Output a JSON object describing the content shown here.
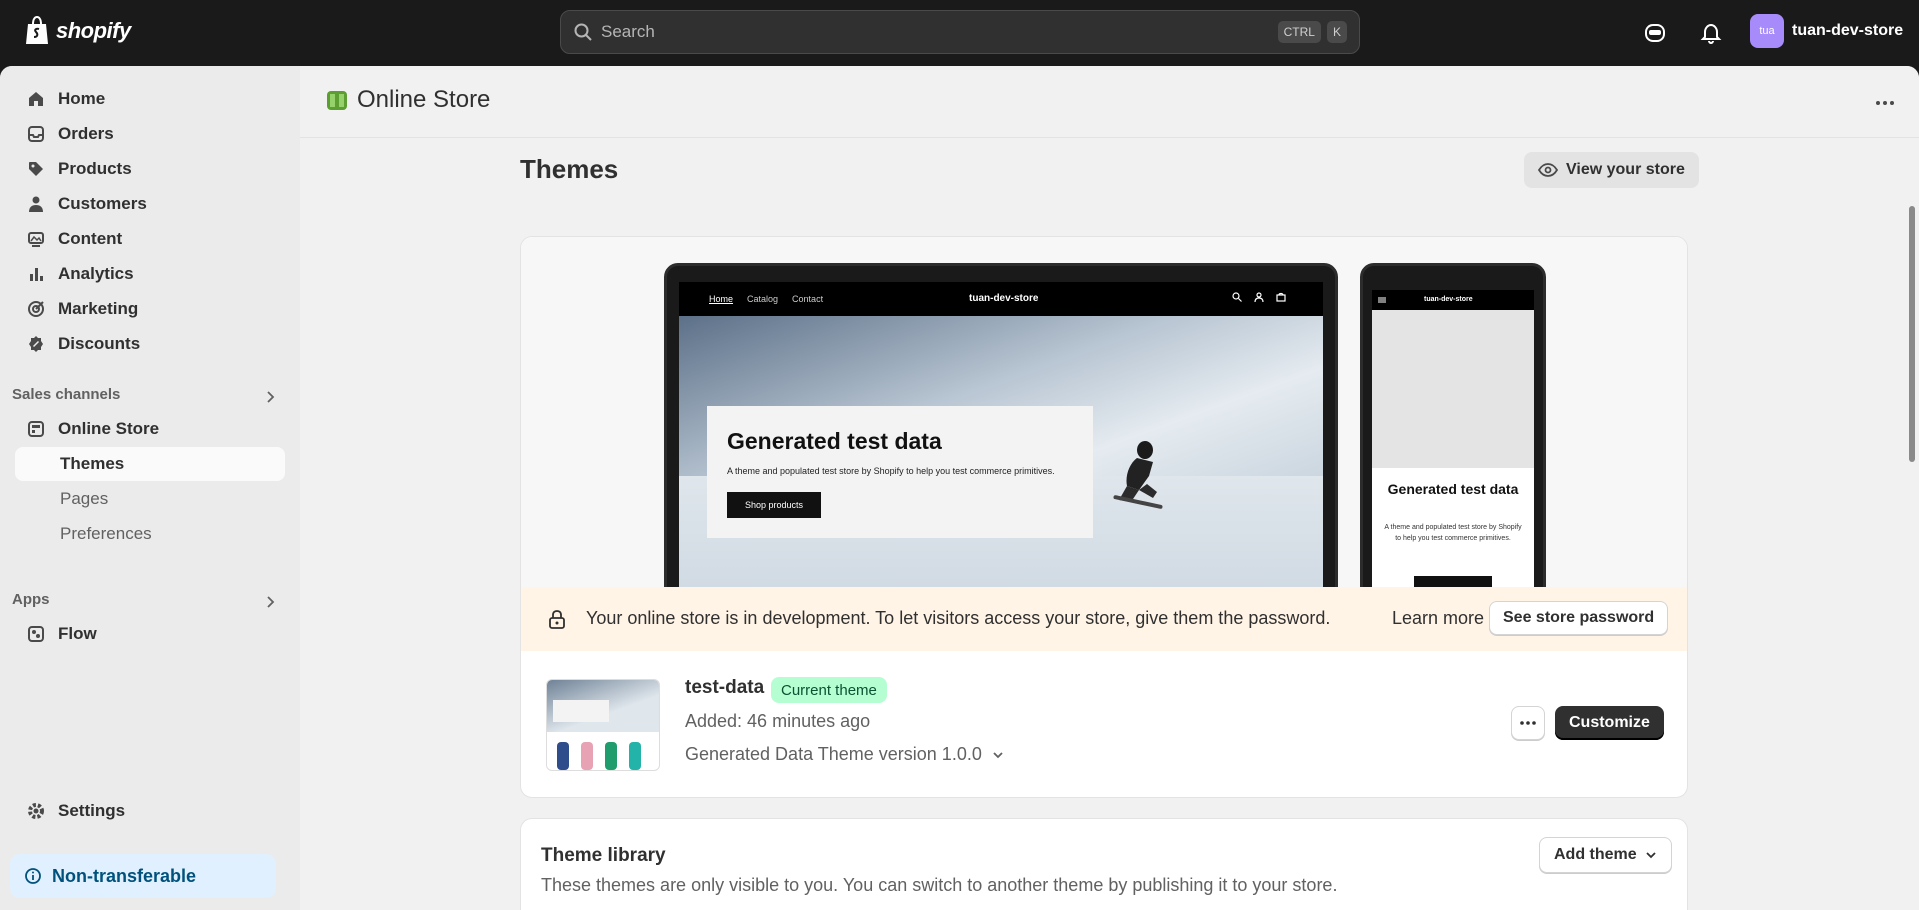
{
  "topbar": {
    "logo_text": "shopify",
    "search_placeholder": "Search",
    "shortcut_key1": "CTRL",
    "shortcut_key2": "K",
    "avatar_initials": "tua",
    "store_name": "tuan-dev-store"
  },
  "sidebar": {
    "items": [
      {
        "label": "Home",
        "icon": "home-icon"
      },
      {
        "label": "Orders",
        "icon": "inbox-icon"
      },
      {
        "label": "Products",
        "icon": "tag-icon"
      },
      {
        "label": "Customers",
        "icon": "person-icon"
      },
      {
        "label": "Content",
        "icon": "image-icon"
      },
      {
        "label": "Analytics",
        "icon": "bar-chart-icon"
      },
      {
        "label": "Marketing",
        "icon": "target-icon"
      },
      {
        "label": "Discounts",
        "icon": "discount-icon"
      }
    ],
    "sales_channels_label": "Sales channels",
    "online_store_label": "Online Store",
    "sub_items": [
      "Themes",
      "Pages",
      "Preferences"
    ],
    "apps_label": "Apps",
    "flow_label": "Flow",
    "settings_label": "Settings",
    "nontransferable_label": "Non-transferable"
  },
  "header": {
    "title": "Online Store"
  },
  "themes": {
    "title": "Themes",
    "view_store_label": "View your store"
  },
  "preview": {
    "nav_links": [
      "Home",
      "Catalog",
      "Contact"
    ],
    "brand": "tuan-dev-store",
    "hero_title": "Generated test data",
    "hero_desc": "A theme and populated test store by Shopify to help you test commerce primitives.",
    "hero_button": "Shop products",
    "phone_title": "Generated test data",
    "phone_desc": "A theme and populated test store by Shopify to help you test commerce primitives."
  },
  "banner": {
    "text": "Your online store is in development. To let visitors access your store, give them the password.",
    "learn_more": "Learn more",
    "password_button": "See store password"
  },
  "current_theme": {
    "name": "test-data",
    "badge": "Current theme",
    "added": "Added: 46 minutes ago",
    "version": "Generated Data Theme version 1.0.0",
    "customize_label": "Customize"
  },
  "library": {
    "title": "Theme library",
    "description": "These themes are only visible to you. You can switch to another theme by publishing it to your store.",
    "add_theme_label": "Add theme"
  },
  "colors": {
    "topbar": "#1a1a1a",
    "current_badge_bg": "#b4fed2",
    "banner_bg": "#fff4e6",
    "nontransferable_bg": "#e0f0ff"
  }
}
